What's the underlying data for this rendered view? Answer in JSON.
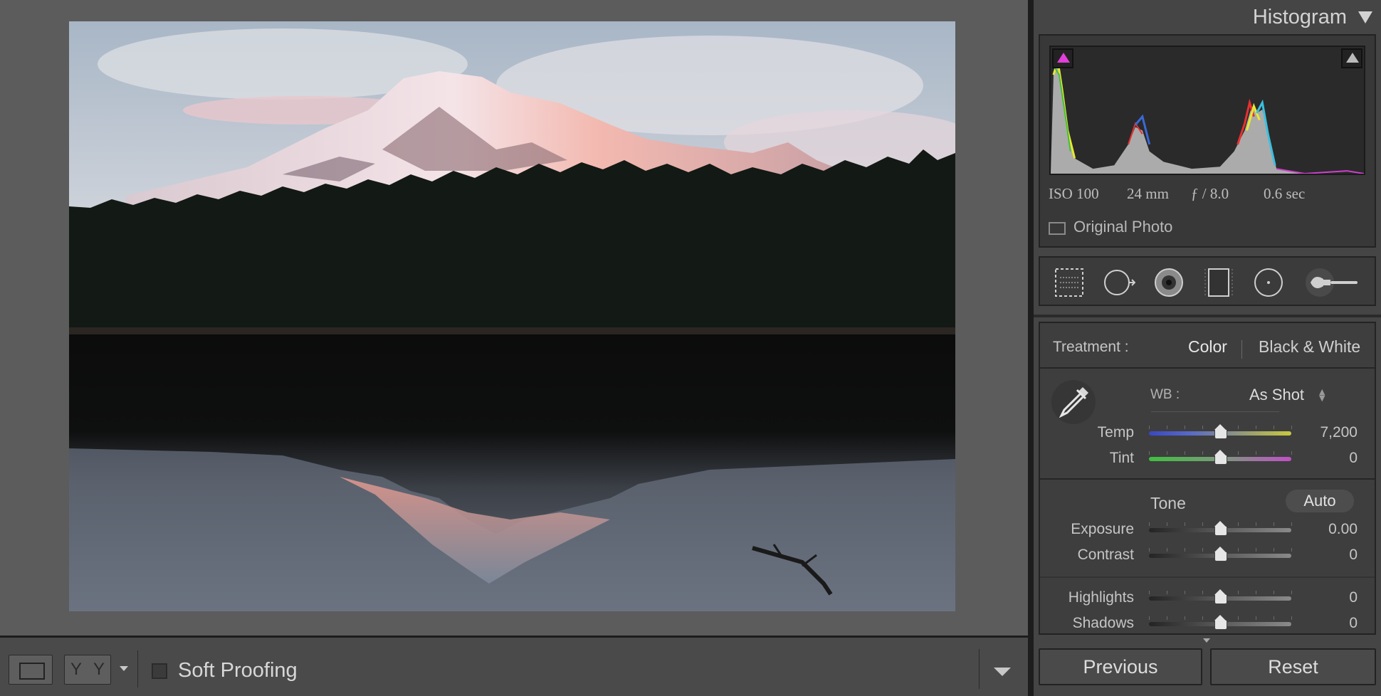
{
  "toolbar": {
    "soft_proofing_label": "Soft Proofing",
    "view_yy_label": "Y Y"
  },
  "histogram": {
    "title": "Histogram",
    "iso": "ISO 100",
    "focal_length": "24 mm",
    "aperture": "ƒ / 8.0",
    "shutter": "0.6 sec",
    "original_photo_label": "Original Photo"
  },
  "tools": [
    "crop-overlay-icon",
    "spot-removal-icon",
    "red-eye-icon",
    "graduated-filter-icon",
    "radial-filter-icon",
    "adjustment-brush-icon"
  ],
  "basic": {
    "treatment_label": "Treatment :",
    "treatment_color": "Color",
    "treatment_bw": "Black & White",
    "wb_label": "WB :",
    "wb_value": "As Shot",
    "temp_label": "Temp",
    "temp_value": "7,200",
    "temp_level": 0.5,
    "tint_label": "Tint",
    "tint_value": "0",
    "tint_level": 0.5,
    "tone_title": "Tone",
    "auto_label": "Auto",
    "exposure_label": "Exposure",
    "exposure_value": "0.00",
    "exposure_level": 0.5,
    "contrast_label": "Contrast",
    "contrast_value": "0",
    "contrast_level": 0.5,
    "highlights_label": "Highlights",
    "highlights_value": "0",
    "highlights_level": 0.5,
    "shadows_label": "Shadows",
    "shadows_value": "0",
    "shadows_level": 0.5
  },
  "footer": {
    "previous_label": "Previous",
    "reset_label": "Reset"
  },
  "colors": {
    "panel_bg": "#454545",
    "viewer_bg": "#5c5c5c",
    "shadow_clip": "#e040d8"
  }
}
